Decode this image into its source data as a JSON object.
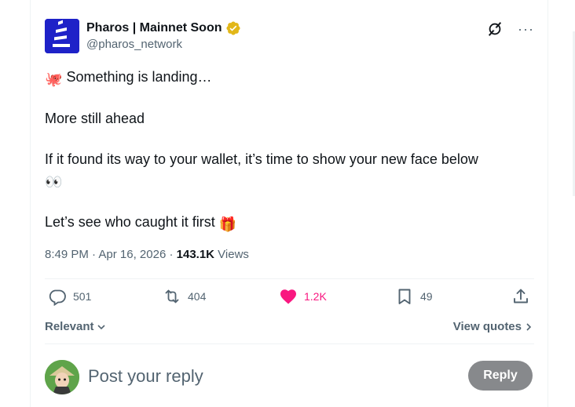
{
  "author": {
    "display_name": "Pharos | Mainnet Soon",
    "handle": "@pharos_network",
    "verified_badge_color": "#e2b719",
    "avatar_bg": "#1e22c8",
    "verified_icon": "verified-badge-icon"
  },
  "header_actions": {
    "grok_icon": "grok-icon",
    "more_label": "···"
  },
  "post": {
    "line1_emoji": "🐙",
    "line1_text": "Something is landing…",
    "line2_text": "More still ahead",
    "line3_text": "If it found its way to your wallet, it’s time to show your new face below",
    "line3_emoji": "👀",
    "line4_text": "Let’s see who caught it first",
    "line4_emoji": "🎁"
  },
  "meta": {
    "time": "8:49 PM",
    "separator1": " · ",
    "date": "Apr 16, 2026",
    "separator2": " · ",
    "views_count": "143.1K",
    "views_label": " Views"
  },
  "actions": {
    "replies": "501",
    "reposts": "404",
    "likes": "1.2K",
    "bookmarks": "49",
    "like_color": "#f91880"
  },
  "sort": {
    "relevant_label": "Relevant",
    "view_quotes_label": "View quotes"
  },
  "reply_box": {
    "placeholder": "Post your reply",
    "button_label": "Reply",
    "button_bg": "#87898c"
  }
}
